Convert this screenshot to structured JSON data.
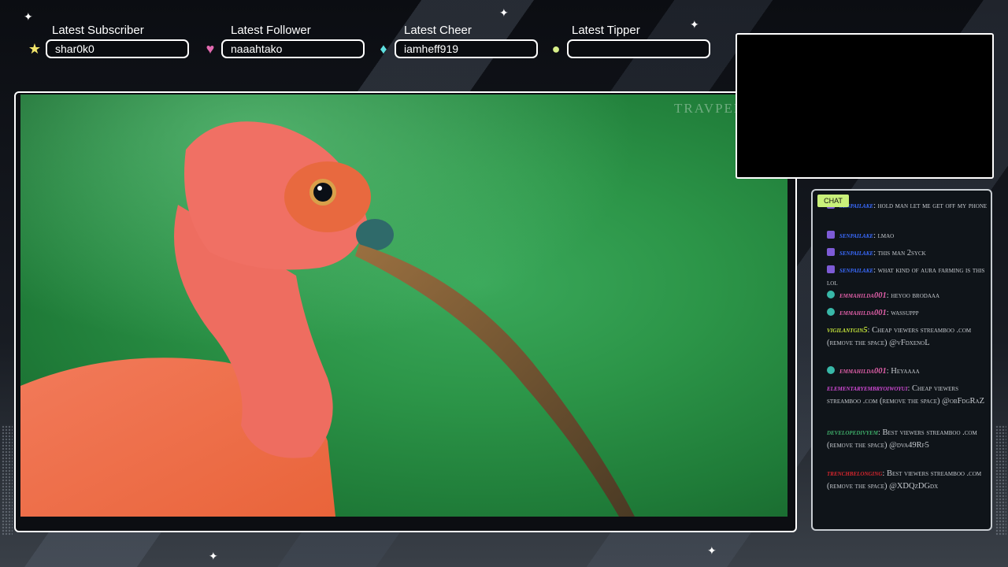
{
  "events": [
    {
      "title": "Latest Subscriber",
      "value": "shar0k0",
      "icon": "star-icon",
      "color": "#f2e56a"
    },
    {
      "title": "Latest Follower",
      "value": "naaahtako",
      "icon": "heart-icon",
      "color": "#e26ab0"
    },
    {
      "title": "Latest Cheer",
      "value": "iamheff919",
      "icon": "gem-icon",
      "color": "#5fe0e0"
    },
    {
      "title": "Latest Tipper",
      "value": "",
      "icon": "coin-icon",
      "color": "#d8f08a"
    }
  ],
  "video": {
    "watermark": "TRAVPEDIA"
  },
  "chat": {
    "label": "CHAT",
    "messages": [
      {
        "user": "senpailake",
        "text": "hold man let me get off my phone",
        "color": "#3a6bff",
        "badge": "purple"
      },
      {
        "user": "senpailake",
        "text": "lmao",
        "color": "#3a6bff",
        "badge": "purple"
      },
      {
        "user": "senpailake",
        "text": "this man 2syck",
        "color": "#3a6bff",
        "badge": "purple"
      },
      {
        "user": "senpailake",
        "text": "what kind of aura farming is this lol",
        "color": "#3a6bff",
        "badge": "purple"
      },
      {
        "user": "emmahilda001",
        "text": "heyoo brodaaa",
        "color": "#e05fa8",
        "badge": "teal"
      },
      {
        "user": "emmahilda001",
        "text": "wassuppp",
        "color": "#e05fa8",
        "badge": "teal"
      },
      {
        "user": "vigilantgin5",
        "text": "Cheap viewers streamboo .com (remove the space) @vFdxenoL",
        "color": "#c6e63a",
        "badge": ""
      },
      {
        "user": "emmahilda001",
        "text": "Heyaaaa",
        "color": "#e05fa8",
        "badge": "teal"
      },
      {
        "user": "elementaryembryoiwoyui",
        "text": "Cheap viewers streamboo .com (remove the space) @obFdgRaZ",
        "color": "#d24ad6",
        "badge": ""
      },
      {
        "user": "developedivyem",
        "text": "Best viewers streamboo .com (remove the space) @dva49Rf5",
        "color": "#3fae6a",
        "badge": ""
      },
      {
        "user": "trenchbelonging",
        "text": "Best viewers streamboo .com (remove the space) @XDQzDGdx",
        "color": "#d8262e",
        "badge": ""
      }
    ]
  }
}
